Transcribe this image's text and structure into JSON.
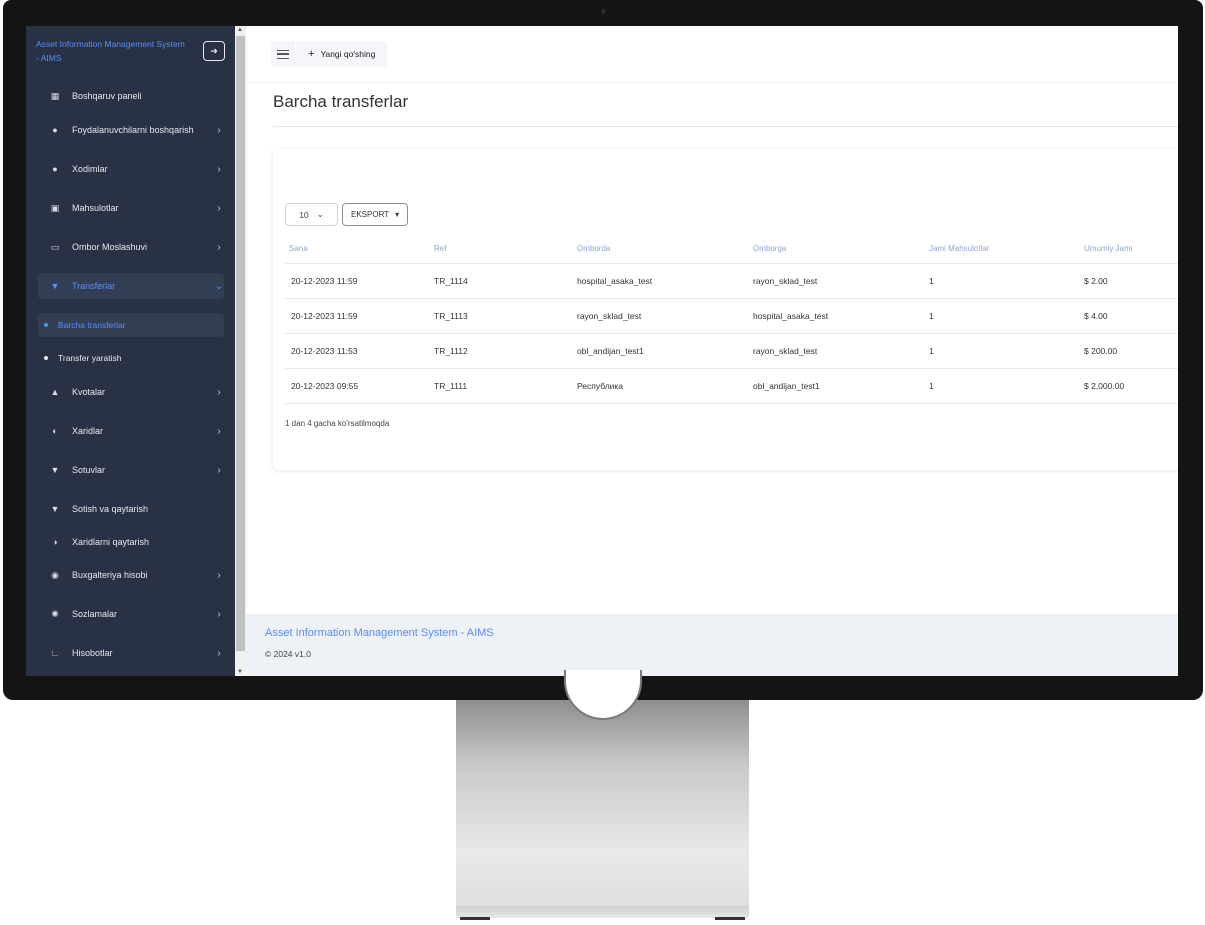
{
  "sidebar": {
    "brand": "Asset Information Management System - AIMS",
    "logout_icon": "logout-icon",
    "items": [
      {
        "label": "Boshqaruv paneli",
        "icon": "dashboard-icon",
        "chevron": ""
      },
      {
        "label": "Foydalanuvchilarni boshqarish",
        "icon": "user-icon",
        "chevron": "›"
      },
      {
        "label": "Xodimlar",
        "icon": "users-icon",
        "chevron": "›"
      },
      {
        "label": "Mahsulotlar",
        "icon": "box-icon",
        "chevron": "›"
      },
      {
        "label": "Ombor Moslashuvi",
        "icon": "warehouse-icon",
        "chevron": "›"
      },
      {
        "label": "Transferlar",
        "icon": "transfer-icon",
        "chevron": "⌄"
      },
      {
        "label": "Kvotalar",
        "icon": "quota-icon",
        "chevron": "›"
      },
      {
        "label": "Xaridlar",
        "icon": "purchase-icon",
        "chevron": "›"
      },
      {
        "label": "Sotuvlar",
        "icon": "sales-icon",
        "chevron": "›"
      },
      {
        "label": "Sotish va qaytarish",
        "icon": "sales-return-icon",
        "chevron": ""
      },
      {
        "label": "Xaridlarni qaytarish",
        "icon": "purchase-return-icon",
        "chevron": ""
      },
      {
        "label": "Buxgalteriya hisobi",
        "icon": "accounting-icon",
        "chevron": "›"
      },
      {
        "label": "Sozlamalar",
        "icon": "settings-icon",
        "chevron": "›"
      },
      {
        "label": "Hisobotlar",
        "icon": "reports-icon",
        "chevron": "›"
      }
    ],
    "subitems": [
      {
        "label": "Barcha transferlar"
      },
      {
        "label": "Transfer yaratish"
      }
    ]
  },
  "topbar": {
    "add_label": "Yangi qo'shing",
    "add_symbol": "+"
  },
  "page": {
    "title": "Barcha transferlar"
  },
  "table": {
    "page_size": "10",
    "export_label": "EKSPORT",
    "headers": [
      "Sana",
      "Ref",
      "Omborda",
      "Omborga",
      "Jami Mahsulotlar",
      "Umumiy Jami"
    ],
    "rows": [
      [
        "20-12-2023 11:59",
        "TR_1114",
        "hospital_asaka_test",
        "rayon_sklad_test",
        "1",
        "$ 2.00"
      ],
      [
        "20-12-2023 11:59",
        "TR_1113",
        "rayon_sklad_test",
        "hospital_asaka_test",
        "1",
        "$ 4.00"
      ],
      [
        "20-12-2023 11:53",
        "TR_1112",
        "obl_andijan_test1",
        "rayon_sklad_test",
        "1",
        "$ 200.00"
      ],
      [
        "20-12-2023 09:55",
        "TR_1111",
        "Республика",
        "obl_andijan_test1",
        "1",
        "$ 2,000.00"
      ]
    ],
    "info": "1 dan 4 gacha ko'rsatilmoqda"
  },
  "footer": {
    "title": "Asset Information Management System - AIMS",
    "version": "© 2024 v1.0"
  }
}
